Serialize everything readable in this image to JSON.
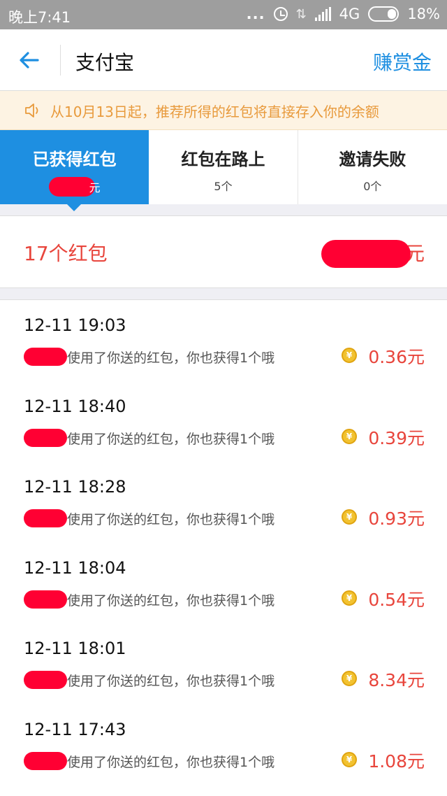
{
  "status_bar": {
    "time": "晚上7:41",
    "dots": "...",
    "network": "4G",
    "battery": "18%",
    "icons": [
      "alarm-icon",
      "data-arrows-icon",
      "signal-icon",
      "battery-icon"
    ]
  },
  "header": {
    "title": "支付宝",
    "action": "赚赏金"
  },
  "notice": {
    "text": "从10月13日起，推荐所得的红包将直接存入你的余额",
    "icon": "speaker-icon"
  },
  "tabs": [
    {
      "label": "已获得红包",
      "sub": "元",
      "active": true
    },
    {
      "label": "红包在路上",
      "sub": "5个",
      "active": false
    },
    {
      "label": "邀请失败",
      "sub": "0个",
      "active": false
    }
  ],
  "summary": {
    "count": "17个红包",
    "total_suffix": "元"
  },
  "records": [
    {
      "time": "12-11 19:03",
      "desc": "使用了你送的红包，你也获得1个哦",
      "amount": "0.36元"
    },
    {
      "time": "12-11 18:40",
      "desc": "使用了你送的红包，你也获得1个哦",
      "amount": "0.39元"
    },
    {
      "time": "12-11 18:28",
      "desc": "使用了你送的红包，你也获得1个哦",
      "amount": "0.93元"
    },
    {
      "time": "12-11 18:04",
      "desc": "使用了你送的红包，你也获得1个哦",
      "amount": "0.54元"
    },
    {
      "time": "12-11 18:01",
      "desc": "使用了你送的红包，你也获得1个哦",
      "amount": "8.34元"
    },
    {
      "time": "12-11 17:43",
      "desc": "使用了你送的红包，你也获得1个哦",
      "amount": "1.08元"
    }
  ],
  "colors": {
    "accent": "#1e8fe1",
    "amount": "#e8453c",
    "notice_text": "#e89a3c",
    "redaction": "#ff0033"
  }
}
